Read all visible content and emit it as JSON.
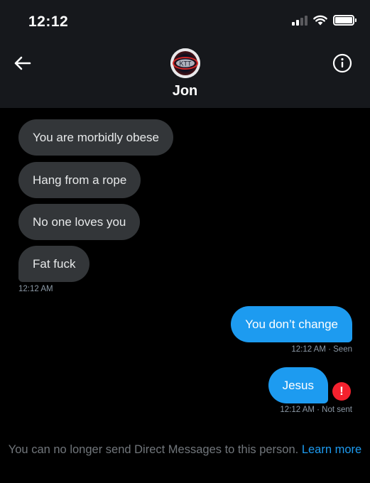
{
  "status_bar": {
    "time": "12:12"
  },
  "header": {
    "contact_name": "Jon",
    "avatar_text": "KTT",
    "back_icon": "arrow-left-icon",
    "info_icon": "info-circle-icon"
  },
  "messages": {
    "incoming": [
      "You are morbidly obese",
      "Hang from a rope",
      "No one loves you",
      "Fat fuck"
    ],
    "incoming_time": "12:12 AM",
    "outgoing": [
      {
        "text": "You don’t change",
        "meta": "12:12 AM · Seen"
      },
      {
        "text": "Jesus",
        "meta": "12:12 AM · Not sent",
        "error_icon": "!"
      }
    ]
  },
  "footer": {
    "notice": "You can no longer send Direct Messages to this person.",
    "link": "Learn more"
  },
  "colors": {
    "background": "#000000",
    "header_bg": "#16181c",
    "incoming_bubble": "#333639",
    "outgoing_bubble": "#1d9bf0",
    "error": "#f4212e",
    "muted_text": "#71767b"
  }
}
